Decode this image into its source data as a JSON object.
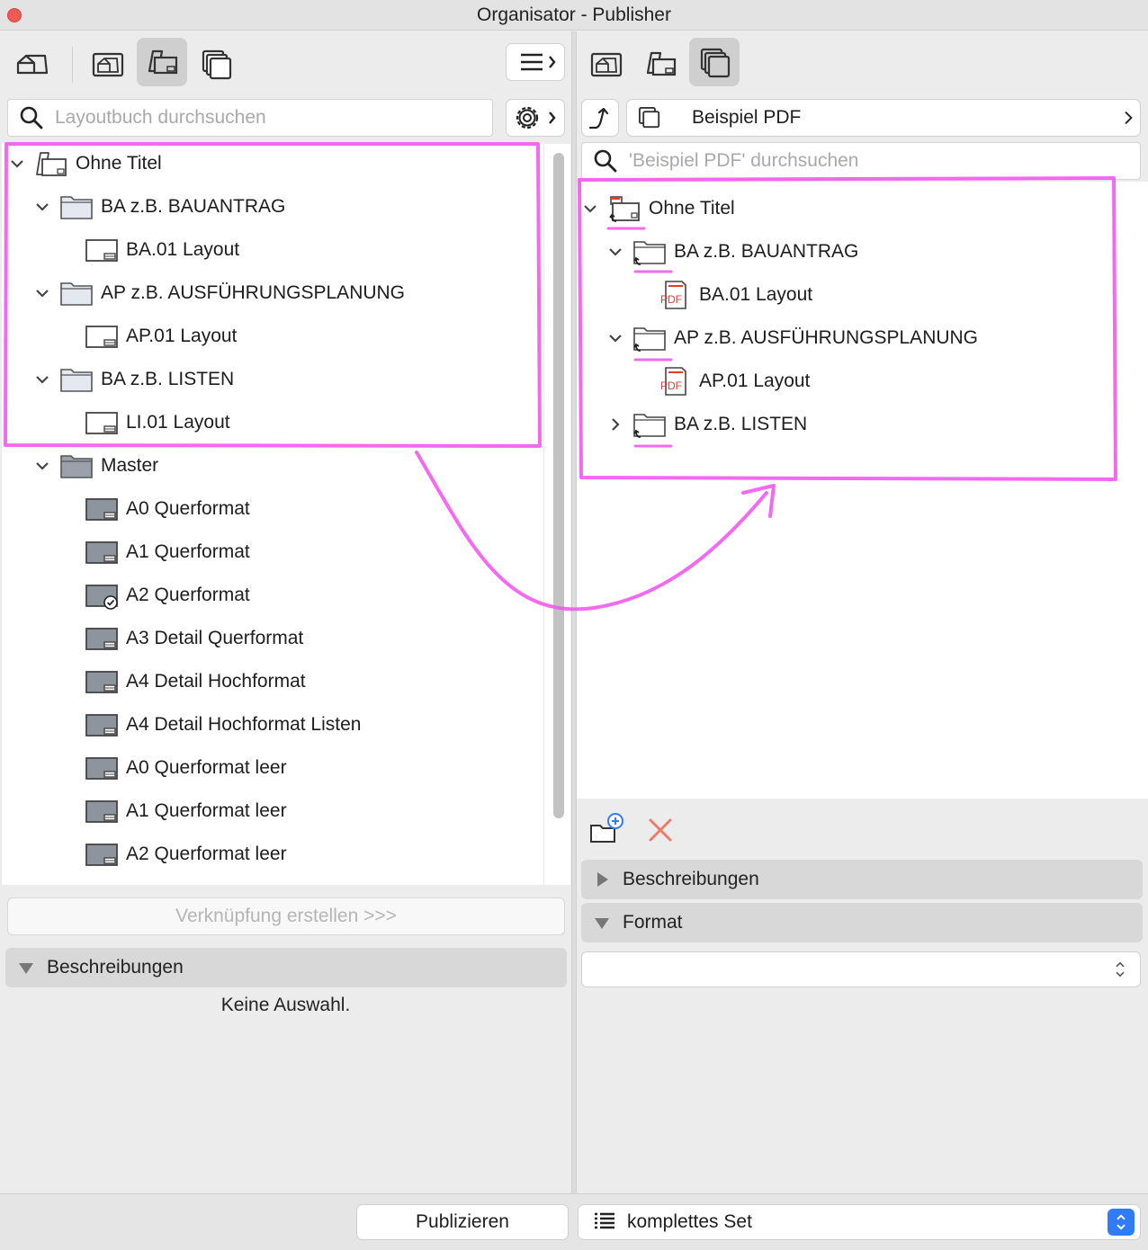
{
  "window": {
    "title": "Organisator - Publisher"
  },
  "left": {
    "search_placeholder": "Layoutbuch durchsuchen",
    "tree": [
      {
        "label": "Ohne Titel",
        "level": 0,
        "kind": "book",
        "expanded": true
      },
      {
        "label": "BA z.B. BAUANTRAG",
        "level": 1,
        "kind": "folder",
        "expanded": true
      },
      {
        "label": "BA.01 Layout",
        "level": 2,
        "kind": "layout"
      },
      {
        "label": "AP z.B. AUSFÜHRUNGSPLANUNG",
        "level": 1,
        "kind": "folder",
        "expanded": true
      },
      {
        "label": "AP.01 Layout",
        "level": 2,
        "kind": "layout"
      },
      {
        "label": "BA z.B. LISTEN",
        "level": 1,
        "kind": "folder",
        "expanded": true
      },
      {
        "label": "LI.01 Layout",
        "level": 2,
        "kind": "layout"
      },
      {
        "label": "Master",
        "level": 1,
        "kind": "master-folder",
        "expanded": true
      },
      {
        "label": "A0 Querformat",
        "level": 2,
        "kind": "master"
      },
      {
        "label": "A1 Querformat",
        "level": 2,
        "kind": "master"
      },
      {
        "label": "A2 Querformat",
        "level": 2,
        "kind": "master-check"
      },
      {
        "label": "A3 Detail Querformat",
        "level": 2,
        "kind": "master"
      },
      {
        "label": "A4 Detail Hochformat",
        "level": 2,
        "kind": "master"
      },
      {
        "label": "A4 Detail Hochformat Listen",
        "level": 2,
        "kind": "master"
      },
      {
        "label": "A0 Querformat leer",
        "level": 2,
        "kind": "master"
      },
      {
        "label": "A1 Querformat leer",
        "level": 2,
        "kind": "master"
      },
      {
        "label": "A2 Querformat leer",
        "level": 2,
        "kind": "master"
      }
    ],
    "link_button": "Verknüpfung erstellen >>>",
    "descriptions_header": "Beschreibungen",
    "no_selection": "Keine Auswahl."
  },
  "right": {
    "set_name": "Beispiel PDF",
    "search_placeholder": "'Beispiel PDF' durchsuchen",
    "tree": [
      {
        "label": "Ohne Titel",
        "level": 0,
        "kind": "pub-book",
        "expanded": true
      },
      {
        "label": "BA z.B. BAUANTRAG",
        "level": 1,
        "kind": "pub-folder",
        "expanded": true
      },
      {
        "label": "BA.01 Layout",
        "level": 2,
        "kind": "pdf"
      },
      {
        "label": "AP z.B. AUSFÜHRUNGSPLANUNG",
        "level": 1,
        "kind": "pub-folder",
        "expanded": true
      },
      {
        "label": "AP.01 Layout",
        "level": 2,
        "kind": "pdf"
      },
      {
        "label": "BA z.B. LISTEN",
        "level": 1,
        "kind": "pub-folder",
        "expanded": false
      }
    ],
    "descriptions_header": "Beschreibungen",
    "format_header": "Format",
    "format_value": "",
    "pdf_icon_text": "PDF"
  },
  "footer": {
    "publish_button": "Publizieren",
    "set_selector": "komplettes Set"
  },
  "colors": {
    "annotation": "#f25af0",
    "accent": "#2f7cf6",
    "delete": "#ec7b6a"
  }
}
